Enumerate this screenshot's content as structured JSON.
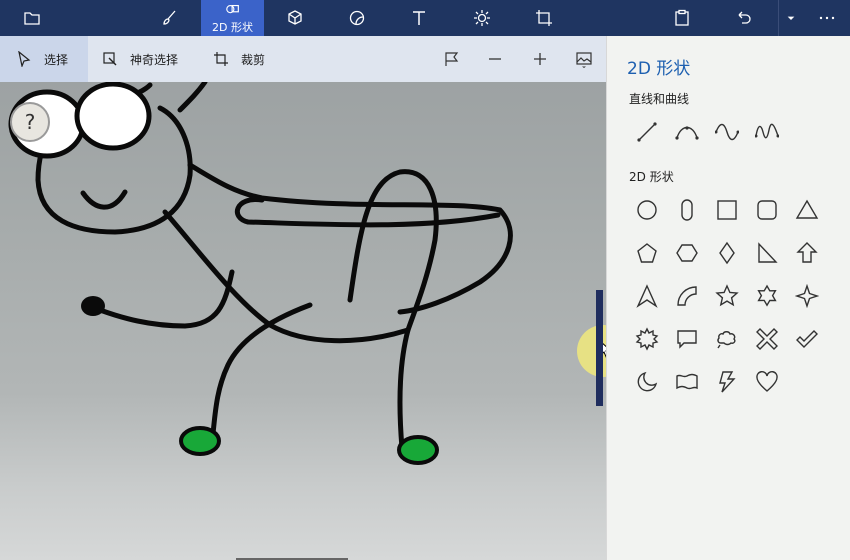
{
  "topbar": {
    "active_tool_label": "2D 形状"
  },
  "toolbar": {
    "select_label": "选择",
    "magic_select_label": "神奇选择",
    "crop_label": "裁剪"
  },
  "canvas": {
    "help_label": "?"
  },
  "panel": {
    "title": "2D 形状",
    "lines_section": "直线和曲线",
    "shapes_section": "2D 形状"
  },
  "colors": {
    "accent": "#3b63c9",
    "title_blue": "#1d5fb0",
    "foot_green": "#18a838"
  }
}
